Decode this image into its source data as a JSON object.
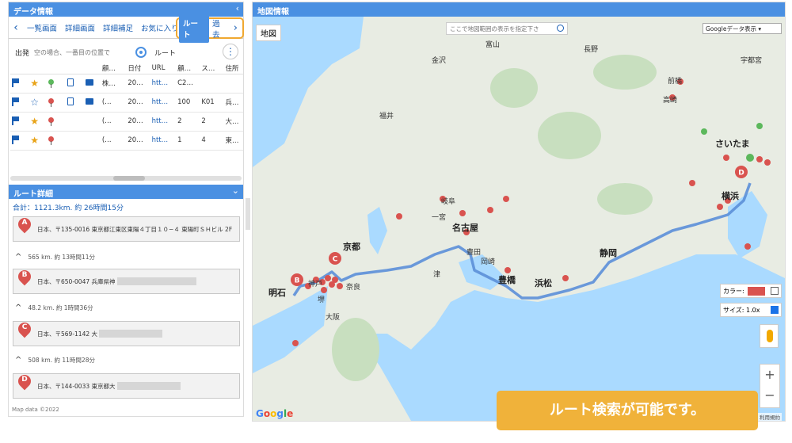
{
  "left_panel": {
    "title": "データ情報",
    "collapse_icon": "chevron-left-icon"
  },
  "tabs": {
    "items": [
      "一覧画面",
      "詳細画面",
      "詳細補足",
      "お気に入り"
    ],
    "active": "ルート",
    "next": "過去"
  },
  "start": {
    "label": "出発",
    "placeholder": "空の場合、一番目の位置で",
    "route_select": "ルート"
  },
  "table": {
    "headers": [
      "",
      "",
      "",
      "",
      "",
      "顧…",
      "日付",
      "URL",
      "顧…",
      "ス…",
      "住所"
    ],
    "rows": [
      {
        "star": "filled",
        "pin": "green",
        "doc": true,
        "memo": true,
        "c1": "株…",
        "date": "20…",
        "url": "htt…",
        "c2": "C2…",
        "s": "",
        "addr": ""
      },
      {
        "star": "empty",
        "pin": "red",
        "doc": true,
        "memo": true,
        "c1": "(…",
        "date": "20…",
        "url": "htt…",
        "c2": "100",
        "s": "K01",
        "addr": "兵…"
      },
      {
        "star": "filled",
        "pin": "red",
        "doc": false,
        "memo": false,
        "c1": "(…",
        "date": "20…",
        "url": "htt…",
        "c2": "2",
        "s": "2",
        "addr": "大…"
      },
      {
        "star": "filled",
        "pin": "red",
        "doc": false,
        "memo": false,
        "c1": "(…",
        "date": "20…",
        "url": "htt…",
        "c2": "1",
        "s": "4",
        "addr": "東…"
      }
    ]
  },
  "route_detail": {
    "title": "ルート詳細",
    "total": "合計：1121.3km. 約 26時間15分",
    "stops": [
      {
        "label": "A",
        "address": "日本、〒135-0016 東京都江東区東陽４丁目１０−４ 東陽町ＳＨビル 2F"
      },
      {
        "label": "B",
        "address": "日本、〒650-0047 兵庫県神"
      },
      {
        "label": "C",
        "address": "日本、〒569-1142 大"
      },
      {
        "label": "D",
        "address": "日本、〒144-0033 東京都大"
      }
    ],
    "legs": [
      "565 km. 約 13時間11分",
      "48.2 km. 約 1時間36分",
      "508 km. 約 11時間28分"
    ],
    "map_data": "Map data ©2022"
  },
  "map_panel": {
    "title": "地図情報",
    "map_button": "地図",
    "search_placeholder": "ここで地図範囲の表示を指定下さ",
    "data_select": "Googleデータ表示",
    "color_label": "カラー:",
    "size_label": "サイズ: 1.0x",
    "terms": "利用規約",
    "google": "Google",
    "colors": {
      "route": "#5b8fd8",
      "marker": "#d9534f",
      "green": "#5cb85c"
    }
  },
  "map_labels": {
    "toyama": "富山",
    "kanazawa": "金沢",
    "fukui": "福井",
    "gifu": "岐阜",
    "nagoya": "名古屋",
    "kyoto": "京都",
    "osaka": "大阪",
    "kobe": "神戸",
    "akashi": "明石",
    "sakai": "堺",
    "nara": "奈良",
    "toyohashi": "豊橋",
    "hamamatsu": "浜松",
    "shizuoka": "静岡",
    "yokohama": "横浜",
    "saitama": "さいたま",
    "maebashi": "前橋",
    "takasaki": "高崎",
    "nagano": "長野",
    "utsunomiya": "宇都宮",
    "toyota": "豊田",
    "okazaki": "岡崎",
    "tsu": "津",
    "ichinomiya": "一宮"
  },
  "toast": "ルート検索が可能です。"
}
